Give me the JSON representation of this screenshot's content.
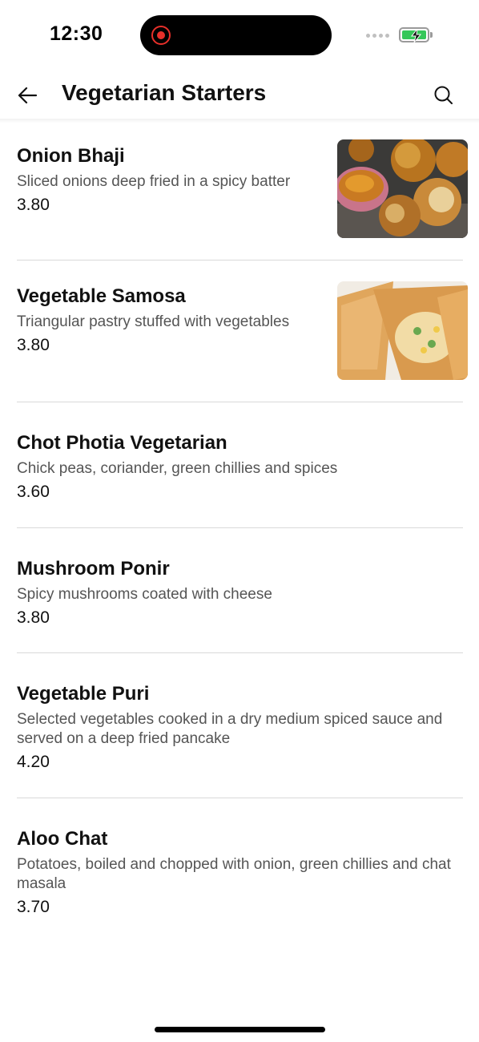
{
  "status_bar": {
    "time": "12:30",
    "icons": [
      "recording-indicator-icon",
      "signal-dots-icon",
      "battery-charging-icon"
    ]
  },
  "header": {
    "title": "Vegetarian Starters",
    "icons": [
      "back-arrow-icon",
      "search-icon"
    ]
  },
  "menu_items": [
    {
      "name": "Onion Bhaji",
      "description": "Sliced onions deep fried in a spicy batter",
      "price": "3.80",
      "has_image": true
    },
    {
      "name": "Vegetable Samosa",
      "description": "Triangular pastry stuffed with vegetables",
      "price": "3.80",
      "has_image": true
    },
    {
      "name": "Chot Photia Vegetarian",
      "description": "Chick peas, coriander, green chillies and spices",
      "price": "3.60",
      "has_image": false
    },
    {
      "name": "Mushroom Ponir",
      "description": "Spicy mushrooms coated with cheese",
      "price": "3.80",
      "has_image": false
    },
    {
      "name": "Vegetable Puri",
      "description": "Selected vegetables cooked in a dry medium spiced sauce and served on a deep fried pancake",
      "price": "4.20",
      "has_image": false
    },
    {
      "name": "Aloo Chat",
      "description": "Potatoes, boiled and chopped with onion, green chillies and chat masala",
      "price": "3.70",
      "has_image": false
    }
  ],
  "colors": {
    "text_primary": "#111111",
    "text_secondary": "#555555",
    "divider": "#d9d9d9",
    "battery_green": "#35c759",
    "recording_red": "#e8302a"
  }
}
